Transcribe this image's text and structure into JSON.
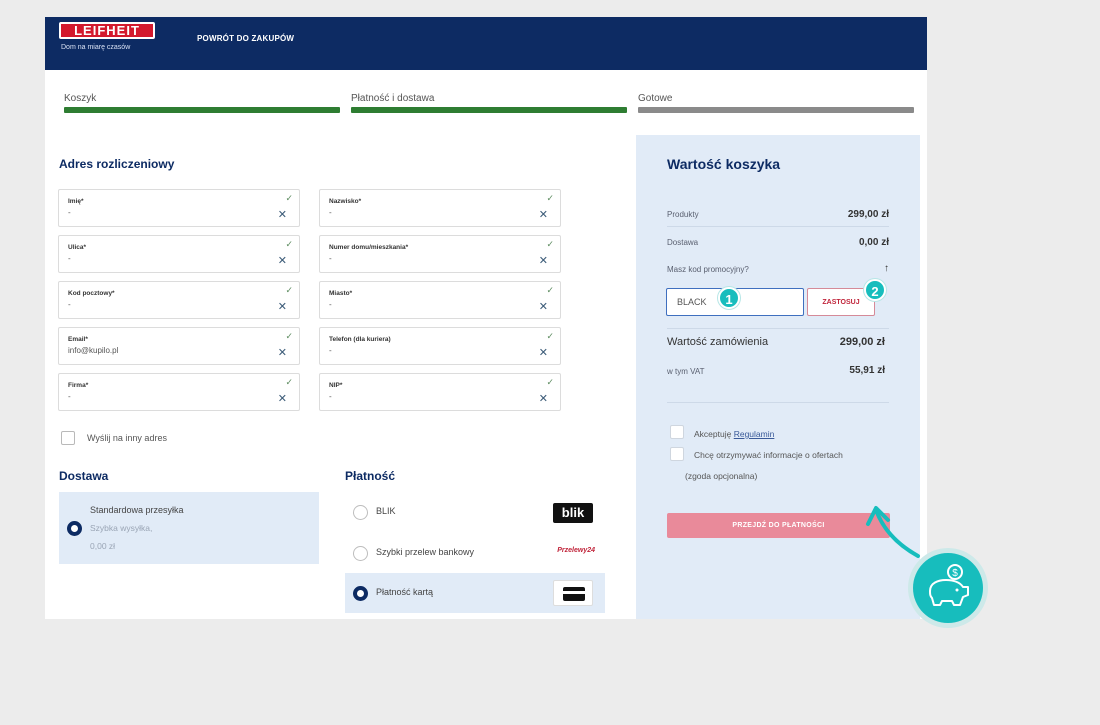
{
  "header": {
    "logo_text": "LEIFHEIT",
    "logo_tagline": "Dom na miarę czasów",
    "back_link": "POWRÓT DO ZAKUPÓW"
  },
  "steps": [
    {
      "label": "Koszyk",
      "status": "done"
    },
    {
      "label": "Płatność i dostawa",
      "status": "done"
    },
    {
      "label": "Gotowe",
      "status": "pending"
    }
  ],
  "billing": {
    "title": "Adres rozliczeniowy",
    "fields": [
      {
        "label": "Imię*",
        "value": "-"
      },
      {
        "label": "Nazwisko*",
        "value": "-"
      },
      {
        "label": "Ulica*",
        "value": "-"
      },
      {
        "label": "Numer domu/mieszkania*",
        "value": "-"
      },
      {
        "label": "Kod pocztowy*",
        "value": "-"
      },
      {
        "label": "Miasto*",
        "value": "-"
      },
      {
        "label": "Email*",
        "value": "info@kupilo.pl"
      },
      {
        "label": "Telefon (dla kuriera)",
        "value": "-"
      },
      {
        "label": "Firma*",
        "value": "-"
      },
      {
        "label": "NIP*",
        "value": "-"
      }
    ],
    "ship_other": "Wyślij na inny adres"
  },
  "delivery": {
    "title": "Dostawa",
    "option_title": "Standardowa przesyłka",
    "option_sub": "Szybka wysyłka,",
    "option_price": "0,00 zł"
  },
  "payment": {
    "title": "Płatność",
    "options": [
      {
        "name": "BLIK",
        "logo": "blik",
        "selected": false
      },
      {
        "name": "Szybki przelew bankowy",
        "logo": "Przelewy24",
        "selected": false
      },
      {
        "name": "Płatność kartą",
        "logo": "credit-card-icon",
        "selected": true
      }
    ]
  },
  "cart": {
    "title": "Wartość koszyka",
    "products_label": "Produkty",
    "products_value": "299,00 zł",
    "delivery_label": "Dostawa",
    "delivery_value": "0,00 zł",
    "promo_question": "Masz kod promocyjny?",
    "promo_value": "BLACK",
    "promo_button": "ZASTOSUJ",
    "order_value_label": "Wartość zamówienia",
    "order_value": "299,00 zł",
    "vat_label": "w tym VAT",
    "vat_value": "55,91 zł",
    "accept_prefix": "Akceptuję",
    "accept_link": "Regulamin",
    "newsletter": "Chcę otrzymywać informacje o ofertach",
    "newsletter_note": "(zgoda opcjonalna)",
    "pay_button": "PRZEJDŹ DO PŁATNOŚCI"
  },
  "annotations": {
    "badge1": "1",
    "badge2": "2",
    "piggy_icon": "piggy-bank-coin-icon",
    "accent_color": "#17bdbd"
  },
  "colors": {
    "navy": "#0d2b63",
    "progress_done": "#2e7d32",
    "cta_pink": "#e98a9a",
    "panel_blue": "#e1ebf7"
  }
}
